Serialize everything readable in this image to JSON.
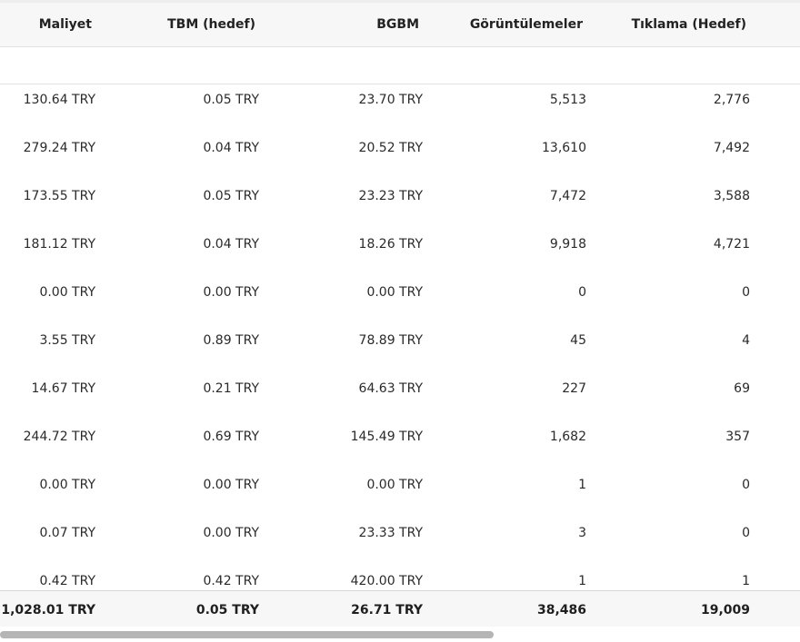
{
  "table": {
    "headers": [
      "Maliyet",
      "TBM (hedef)",
      "BGBM",
      "Görüntülemeler",
      "Tıklama (Hedef)"
    ],
    "rows": [
      [
        "130.64 TRY",
        "0.05 TRY",
        "23.70 TRY",
        "5,513",
        "2,776"
      ],
      [
        "279.24 TRY",
        "0.04 TRY",
        "20.52 TRY",
        "13,610",
        "7,492"
      ],
      [
        "173.55 TRY",
        "0.05 TRY",
        "23.23 TRY",
        "7,472",
        "3,588"
      ],
      [
        "181.12 TRY",
        "0.04 TRY",
        "18.26 TRY",
        "9,918",
        "4,721"
      ],
      [
        "0.00 TRY",
        "0.00 TRY",
        "0.00 TRY",
        "0",
        "0"
      ],
      [
        "3.55 TRY",
        "0.89 TRY",
        "78.89 TRY",
        "45",
        "4"
      ],
      [
        "14.67 TRY",
        "0.21 TRY",
        "64.63 TRY",
        "227",
        "69"
      ],
      [
        "244.72 TRY",
        "0.69 TRY",
        "145.49 TRY",
        "1,682",
        "357"
      ],
      [
        "0.00 TRY",
        "0.00 TRY",
        "0.00 TRY",
        "1",
        "0"
      ],
      [
        "0.07 TRY",
        "0.00 TRY",
        "23.33 TRY",
        "3",
        "0"
      ],
      [
        "0.42 TRY",
        "0.42 TRY",
        "420.00 TRY",
        "1",
        "1"
      ]
    ],
    "totals": [
      "1,028.01 TRY",
      "0.05 TRY",
      "26.71 TRY",
      "38,486",
      "19,009"
    ]
  },
  "scroll": {
    "horizontal_position": 0,
    "visible_fraction": 0.62
  }
}
